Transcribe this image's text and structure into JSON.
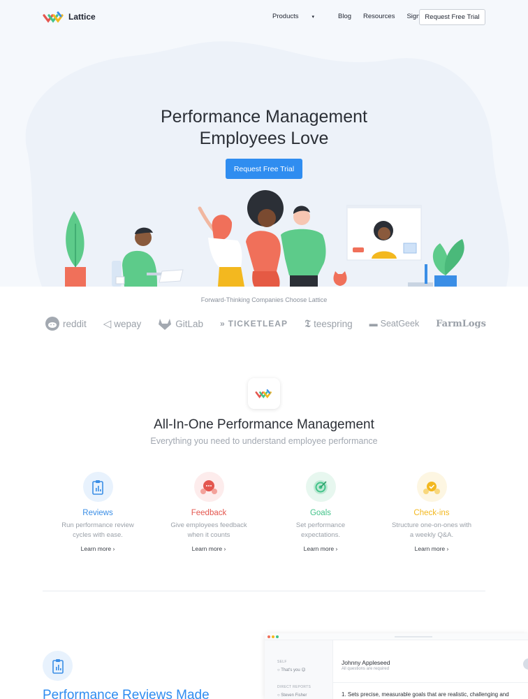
{
  "brand": {
    "name": "Lattice"
  },
  "nav": {
    "items": [
      "Products",
      "Blog",
      "Resources",
      "Sign in"
    ],
    "products_caret": "▾",
    "cta": "Request Free Trial"
  },
  "hero": {
    "title_line1": "Performance Management",
    "title_line2": "Employees Love",
    "cta": "Request Free Trial"
  },
  "companies": {
    "title": "Forward-Thinking Companies Choose Lattice",
    "logos": [
      "reddit",
      "wepay",
      "GitLab",
      "TICKETLEAP",
      "teespring",
      "SeatGeek",
      "FarmLogs"
    ]
  },
  "section": {
    "title": "All-In-One Performance Management",
    "subtitle": "Everything you need to understand employee performance"
  },
  "features": [
    {
      "name": "Reviews",
      "desc_line1": "Run performance review",
      "desc_line2": "cycles with ease.",
      "link": "Learn more ›",
      "color": "#3a8ee6",
      "bg": "#e8f2fd"
    },
    {
      "name": "Feedback",
      "desc_line1": "Give employees feedback",
      "desc_line2": "when it counts",
      "link": "Learn more ›",
      "color": "#e4574f",
      "bg": "#fdecec"
    },
    {
      "name": "Goals",
      "desc_line1": "Set performance",
      "desc_line2": "expectations.",
      "link": "Learn more ›",
      "color": "#43c38a",
      "bg": "#e7f7ef"
    },
    {
      "name": "Check-ins",
      "desc_line1": "Structure one-on-ones with",
      "desc_line2": "a weekly Q&A.",
      "link": "Learn more ›",
      "color": "#f3b81f",
      "bg": "#fdf6e2"
    }
  ],
  "bottom": {
    "title": "Performance Reviews Made"
  },
  "app_preview": {
    "self_label": "SELF",
    "self_item": "That's you 😉",
    "reports_label": "DIRECT REPORTS",
    "reports_item": "Steven Fisher",
    "person": "Johnny Appleseed",
    "required": "All questions are required",
    "goal": "1. Sets precise, measurable goals that are realistic, challenging and"
  }
}
